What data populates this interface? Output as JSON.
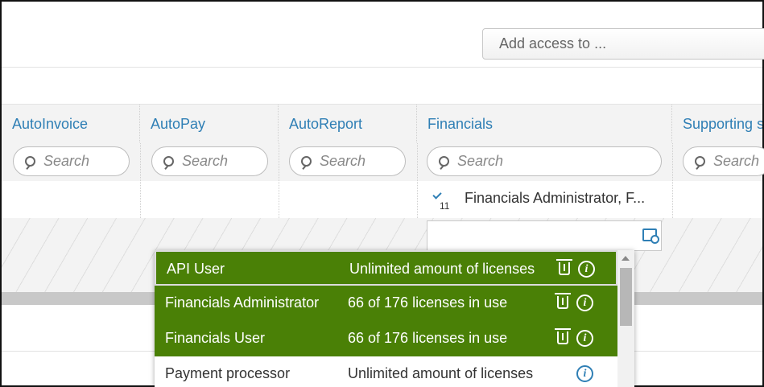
{
  "toolbar": {
    "add_access_placeholder": "Add access to ..."
  },
  "columns": [
    {
      "header": "AutoInvoice",
      "search_placeholder": "Search"
    },
    {
      "header": "AutoPay",
      "search_placeholder": "Search"
    },
    {
      "header": "AutoReport",
      "search_placeholder": "Search"
    },
    {
      "header": "Financials",
      "search_placeholder": "Search"
    },
    {
      "header": "Supporting s",
      "search_placeholder": "Search"
    }
  ],
  "row": {
    "financials_roles_text": "Financials Administrator, F...",
    "financials_roles_count": "11"
  },
  "dropdown": {
    "options": [
      {
        "name": "API User",
        "licenses": "Unlimited amount of licenses",
        "selected": true
      },
      {
        "name": "Financials Administrator",
        "licenses": "66 of 176 licenses in use",
        "selected": true
      },
      {
        "name": "Financials User",
        "licenses": "66 of 176 licenses in use",
        "selected": true
      },
      {
        "name": "Payment processor",
        "licenses": "Unlimited amount of licenses",
        "selected": false
      }
    ],
    "info_glyph": "i"
  },
  "colors": {
    "accent_blue": "#2f7fb5",
    "selected_green": "#4a8006"
  },
  "icons": [
    "search-icon",
    "check-icon",
    "lookup-icon",
    "trash-icon",
    "info-icon",
    "scroll-up-arrow-icon"
  ]
}
